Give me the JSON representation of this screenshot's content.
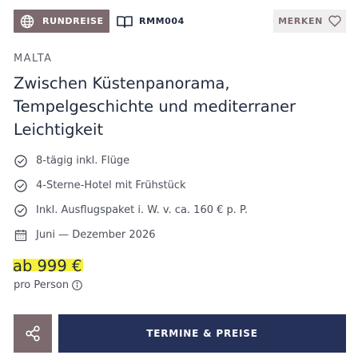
{
  "header": {
    "type_badge": "RUNDREISE",
    "code": "RMM004",
    "save_label": "MERKEN"
  },
  "offer": {
    "country": "MALTA",
    "title": "Zwischen Küstenpanorama, Tempelgeschichte und mediterraner Leichtigkeit",
    "features": [
      {
        "icon": "check-circle-icon",
        "text": "8-tägig inkl. Flüge"
      },
      {
        "icon": "check-circle-icon",
        "text": "4-Sterne-Hotel mit Frühstück"
      },
      {
        "icon": "check-circle-icon",
        "text": "Inkl. Ausflugspaket i. W. v. ca. 160 € p. P."
      },
      {
        "icon": "calendar-icon",
        "text": "Juni — Dezember 2026"
      }
    ],
    "price": "ab 999 €",
    "price_unit": "pro Person"
  },
  "actions": {
    "cta_label": "TERMINE & PREISE"
  },
  "colors": {
    "badge": "#7c6a6e",
    "cta": "#26315a",
    "highlight": "#f5ef3d"
  }
}
